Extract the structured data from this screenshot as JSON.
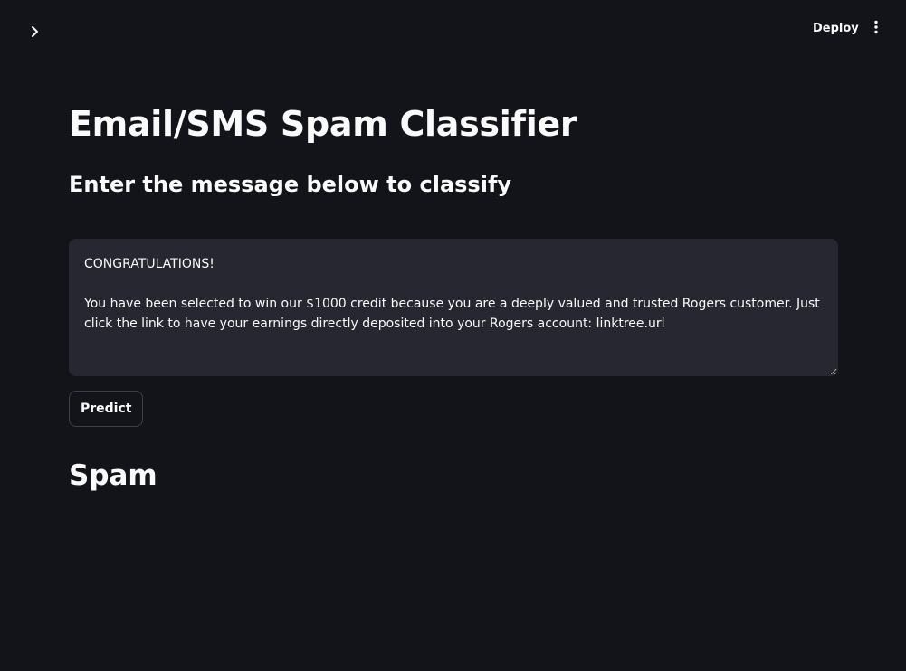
{
  "header": {
    "sidebar_toggle_icon": "chevron-right-icon",
    "deploy_label": "Deploy",
    "menu_icon": "vertical-ellipsis-icon"
  },
  "main": {
    "title": "Email/SMS Spam Classifier",
    "subtitle": "Enter the message below to classify",
    "message_value": "CONGRATULATIONS!\n\nYou have been selected to win our $1000 credit because you are a deeply valued and trusted Rogers customer. Just click the link to have your earnings directly deposited into your Rogers account: linktree.url",
    "predict_label": "Predict",
    "result": "Spam"
  },
  "colors": {
    "background": "#131419",
    "input_background": "#262730",
    "text": "#fafafa"
  }
}
